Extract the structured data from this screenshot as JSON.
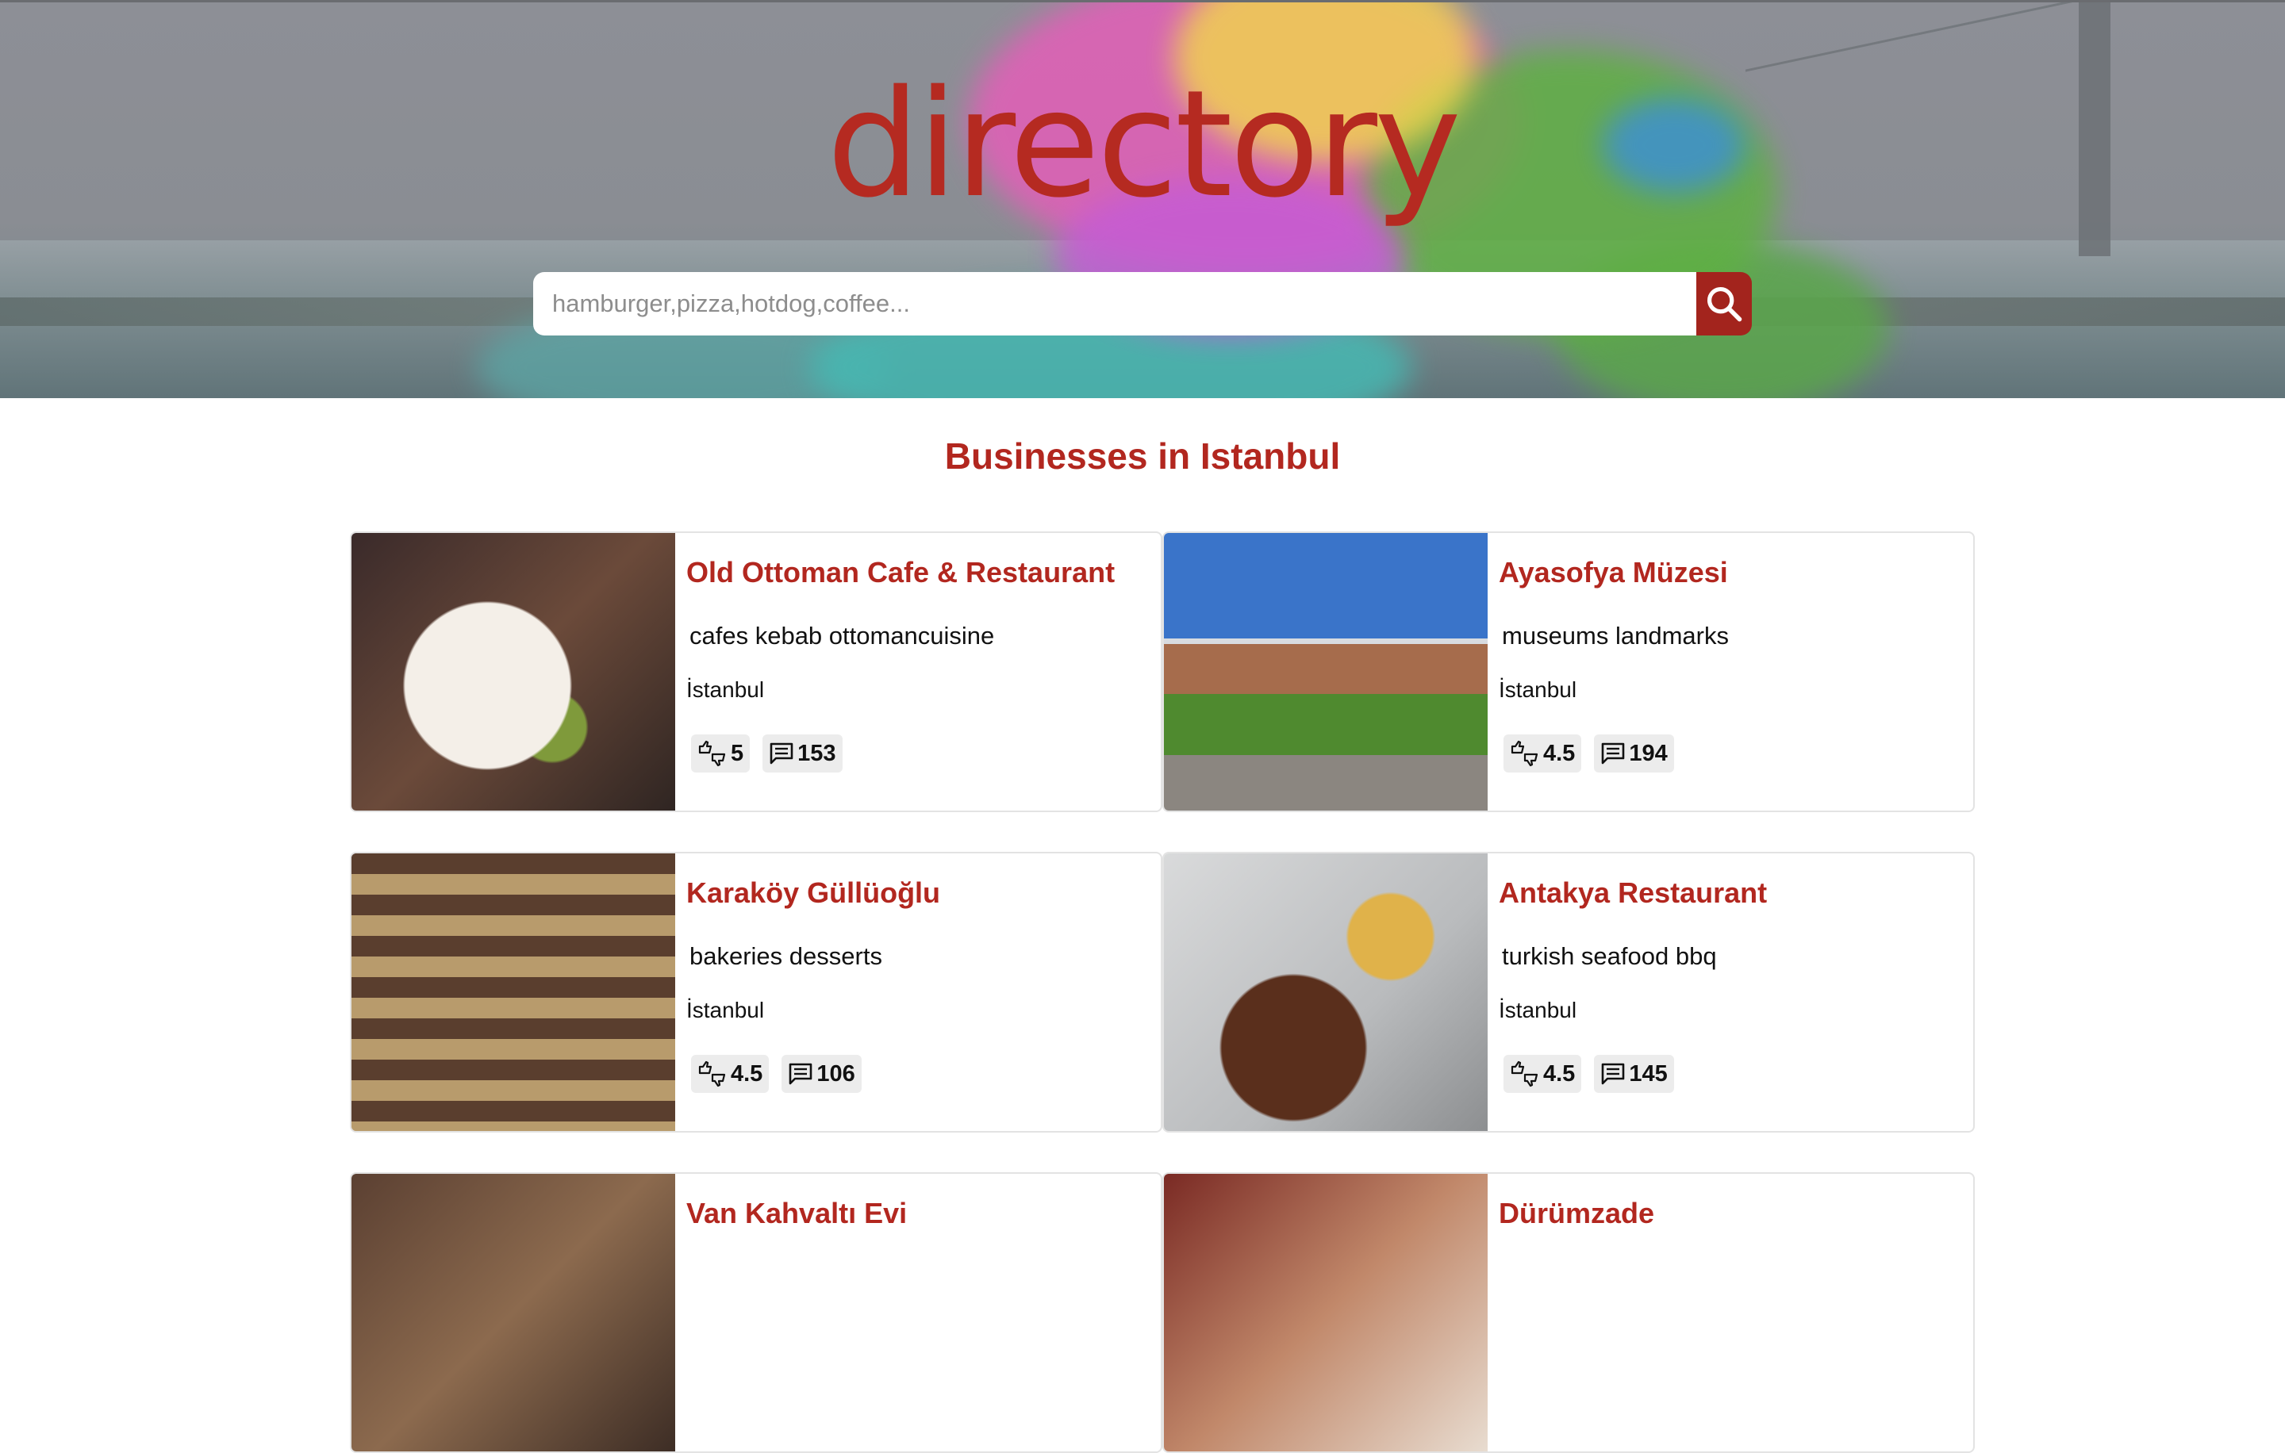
{
  "header": {
    "logo_text": "directory",
    "search": {
      "placeholder": "hamburger,pizza,hotdog,coffee...",
      "value": ""
    }
  },
  "section": {
    "title": "Businesses in Istanbul"
  },
  "businesses": [
    {
      "name": "Old Ottoman Cafe & Restaurant",
      "categories": "cafes kebab ottomancuisine",
      "city": "İstanbul",
      "rating": "5",
      "reviews": "153"
    },
    {
      "name": "Ayasofya Müzesi",
      "categories": "museums landmarks",
      "city": "İstanbul",
      "rating": "4.5",
      "reviews": "194"
    },
    {
      "name": "Karaköy Güllüoğlu",
      "categories": "bakeries desserts",
      "city": "İstanbul",
      "rating": "4.5",
      "reviews": "106"
    },
    {
      "name": "Antakya Restaurant",
      "categories": "turkish seafood bbq",
      "city": "İstanbul",
      "rating": "4.5",
      "reviews": "145"
    },
    {
      "name": "Van Kahvaltı Evi"
    },
    {
      "name": "Dürümzade"
    }
  ],
  "colors": {
    "accent": "#b2271f",
    "search_button": "#a3241d",
    "badge_bg": "#ececec"
  },
  "icons": {
    "search": "search-icon",
    "rating": "thumbs-up-down-icon",
    "reviews": "comment-icon"
  }
}
